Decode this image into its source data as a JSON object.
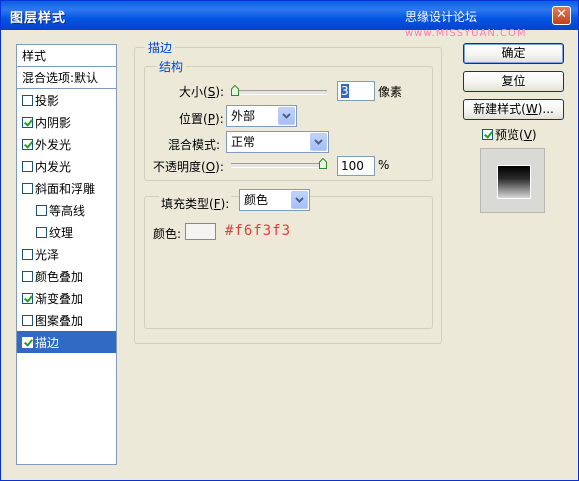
{
  "window": {
    "title": "图层样式",
    "watermark_text": "思缘设计论坛",
    "watermark_url": "www.MISSYUAN.COM",
    "close_symbol": "✕"
  },
  "left_panel": {
    "header": "样式",
    "blend_options": "混合选项:默认",
    "items": [
      {
        "label": "投影",
        "checked": false,
        "indent": false,
        "selected": false
      },
      {
        "label": "内阴影",
        "checked": true,
        "indent": false,
        "selected": false
      },
      {
        "label": "外发光",
        "checked": true,
        "indent": false,
        "selected": false
      },
      {
        "label": "内发光",
        "checked": false,
        "indent": false,
        "selected": false
      },
      {
        "label": "斜面和浮雕",
        "checked": false,
        "indent": false,
        "selected": false
      },
      {
        "label": "等高线",
        "checked": false,
        "indent": true,
        "selected": false
      },
      {
        "label": "纹理",
        "checked": false,
        "indent": true,
        "selected": false
      },
      {
        "label": "光泽",
        "checked": false,
        "indent": false,
        "selected": false
      },
      {
        "label": "颜色叠加",
        "checked": false,
        "indent": false,
        "selected": false
      },
      {
        "label": "渐变叠加",
        "checked": true,
        "indent": false,
        "selected": false
      },
      {
        "label": "图案叠加",
        "checked": false,
        "indent": false,
        "selected": false
      },
      {
        "label": "描边",
        "checked": true,
        "indent": false,
        "selected": true
      }
    ]
  },
  "stroke": {
    "title": "描边",
    "structure_title": "结构",
    "size_label": "大小(",
    "size_key": "S",
    "size_label_end": "):",
    "size_value": "3",
    "size_unit": "像素",
    "size_slider_fraction": 0.0,
    "position_label": "位置(",
    "position_key": "P",
    "position_label_end": "):",
    "position_value": "外部",
    "blend_mode_label": "混合模式:",
    "blend_mode_value": "正常",
    "opacity_label": "不透明度(",
    "opacity_key": "O",
    "opacity_label_end": "):",
    "opacity_value": "100",
    "opacity_unit": "%",
    "opacity_slider_fraction": 1.0,
    "fill_type_label": "填充类型(",
    "fill_type_key": "F",
    "fill_type_label_end": "):",
    "fill_type_value": "颜色",
    "color_label": "颜色:",
    "color_value": "#f6f3f3",
    "color_hex_text": "#f6f3f3"
  },
  "buttons": {
    "ok": "确定",
    "reset": "复位",
    "new_style": "新建样式(",
    "new_style_key": "W",
    "new_style_end": ")...",
    "preview_label": "预览(",
    "preview_key": "V",
    "preview_end": ")",
    "preview_checked": true
  }
}
